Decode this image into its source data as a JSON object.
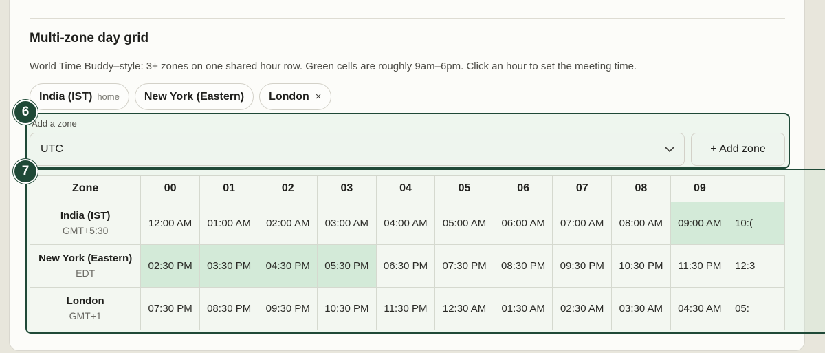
{
  "section": {
    "title": "Multi-zone day grid",
    "description": "World Time Buddy–style: 3+ zones on one shared hour row. Green cells are roughly 9am–6pm. Click an hour to set the meeting time."
  },
  "chips": [
    {
      "label": "India (IST)",
      "tag": "home"
    },
    {
      "label": "New York (Eastern)"
    },
    {
      "label": "London",
      "remove": "×"
    }
  ],
  "annotations": {
    "add_zone": "6",
    "grid": "7"
  },
  "add_zone": {
    "label": "Add a zone",
    "selected": "UTC",
    "button": "+ Add zone"
  },
  "grid": {
    "header": "Zone",
    "hours": [
      "00",
      "01",
      "02",
      "03",
      "04",
      "05",
      "06",
      "07",
      "08",
      "09",
      ""
    ],
    "rows": [
      {
        "name": "India (IST)",
        "offset": "GMT+5:30",
        "cells": [
          "12:00 AM",
          "01:00 AM",
          "02:00 AM",
          "03:00 AM",
          "04:00 AM",
          "05:00 AM",
          "06:00 AM",
          "07:00 AM",
          "08:00 AM",
          "09:00 AM",
          "10:("
        ],
        "work": [
          false,
          false,
          false,
          false,
          false,
          false,
          false,
          false,
          false,
          true,
          true
        ]
      },
      {
        "name": "New York (Eastern)",
        "offset": "EDT",
        "cells": [
          "02:30 PM",
          "03:30 PM",
          "04:30 PM",
          "05:30 PM",
          "06:30 PM",
          "07:30 PM",
          "08:30 PM",
          "09:30 PM",
          "10:30 PM",
          "11:30 PM",
          "12:3"
        ],
        "work": [
          true,
          true,
          true,
          true,
          false,
          false,
          false,
          false,
          false,
          false,
          false
        ]
      },
      {
        "name": "London",
        "offset": "GMT+1",
        "cells": [
          "07:30 PM",
          "08:30 PM",
          "09:30 PM",
          "10:30 PM",
          "11:30 PM",
          "12:30 AM",
          "01:30 AM",
          "02:30 AM",
          "03:30 AM",
          "04:30 AM",
          "05:"
        ],
        "work": [
          false,
          false,
          false,
          false,
          false,
          false,
          false,
          false,
          false,
          false,
          false
        ]
      }
    ]
  },
  "colors": {
    "work_cell": "#d3ead8",
    "annotation": "#1f4937",
    "background": "#f3f7f1"
  }
}
